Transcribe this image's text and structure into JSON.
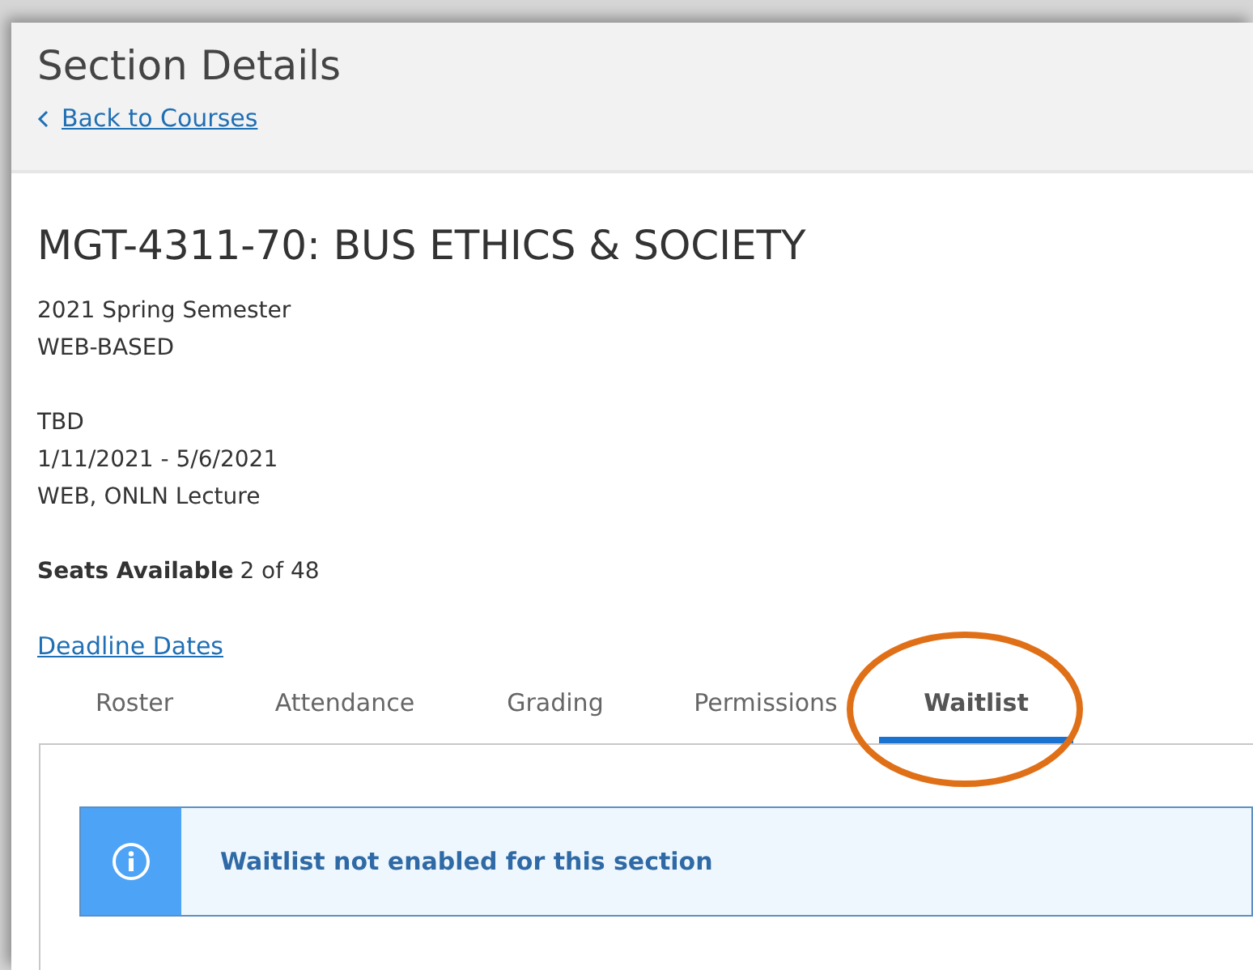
{
  "header": {
    "title": "Section Details",
    "back_link": "Back to Courses"
  },
  "course": {
    "title": "MGT-4311-70: BUS ETHICS & SOCIETY",
    "term": "2021 Spring Semester",
    "delivery": "WEB-BASED",
    "time": "TBD",
    "dates": "1/11/2021 - 5/6/2021",
    "location": "WEB, ONLN Lecture",
    "seats_label": "Seats Available",
    "seats_value": "2 of 48",
    "deadline_link": "Deadline Dates"
  },
  "tabs": [
    {
      "label": "Roster",
      "selected": false,
      "highlighted": false
    },
    {
      "label": "Attendance",
      "selected": false,
      "highlighted": false
    },
    {
      "label": "Grading",
      "selected": false,
      "highlighted": false
    },
    {
      "label": "Permissions",
      "selected": false,
      "highlighted": false
    },
    {
      "label": "Waitlist",
      "selected": true,
      "highlighted": true
    }
  ],
  "alert": {
    "kind": "info",
    "message": "Waitlist not enabled for this section"
  }
}
